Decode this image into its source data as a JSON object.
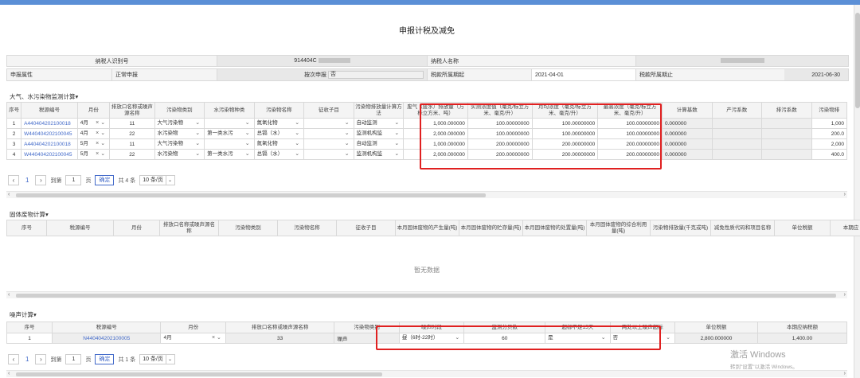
{
  "page_title": "申报计税及减免",
  "info": {
    "taxpayer_id_label": "纳税人识别号",
    "taxpayer_id_value": "914404C",
    "taxpayer_name_label": "纳税人名称",
    "report_attr_label": "申报属性",
    "report_attr_value": "正常申报",
    "by_period_label": "按次申报",
    "by_period_value": "否",
    "period_start_label": "税款所属期起",
    "period_start_value": "2021-04-01",
    "period_end_label": "税款所属期止",
    "period_end_value": "2021-06-30"
  },
  "air_water": {
    "section_title": "大气、水污染物监测计算",
    "headers": [
      "序号",
      "税源编号",
      "月份",
      "排放口名称或噪声源名称",
      "污染物类别",
      "水污染物种类",
      "污染物名称",
      "征收子目",
      "污染物排放量计算方法",
      "废气（废水）排放量（万标立方米、吨）",
      "实测浓度值（毫克/标立方米、毫克/升）",
      "月均浓度（毫克/标立方米、毫克/升）",
      "最高浓度（毫克/标立方米、毫克/升）",
      "计算基数",
      "产污系数",
      "排污系数",
      "污染物排"
    ],
    "rows": [
      {
        "no": "1",
        "source": "A440404202100018",
        "month": "4月",
        "outlet": "11",
        "category": "大气污染物",
        "water_type": "",
        "pollutant": "氮氧化物",
        "item": "",
        "method": "自动监测",
        "emission": "1,000.000000",
        "measured": "100.00000000",
        "avg": "100.00000000",
        "max": "100.00000000",
        "base": "0.000000",
        "extra": "1,000"
      },
      {
        "no": "2",
        "source": "W440404202100045",
        "month": "4月",
        "outlet": "22",
        "category": "水污染物",
        "water_type": "第一类水污",
        "pollutant": "总镉（水）",
        "item": "",
        "method": "监测机构监",
        "emission": "2,000.000000",
        "measured": "100.00000000",
        "avg": "100.00000000",
        "max": "100.00000000",
        "base": "0.000000",
        "extra": "200.0"
      },
      {
        "no": "3",
        "source": "A440404202100018",
        "month": "5月",
        "outlet": "11",
        "category": "大气污染物",
        "water_type": "",
        "pollutant": "氮氧化物",
        "item": "",
        "method": "自动监测",
        "emission": "1,000.000000",
        "measured": "200.00000000",
        "avg": "200.00000000",
        "max": "200.00000000",
        "base": "0.000000",
        "extra": "2,000"
      },
      {
        "no": "4",
        "source": "W440404202100045",
        "month": "5月",
        "outlet": "22",
        "category": "水污染物",
        "water_type": "第一类水污",
        "pollutant": "总镉（水）",
        "item": "",
        "method": "监测机构监",
        "emission": "2,000.000000",
        "measured": "200.00000000",
        "avg": "200.00000000",
        "max": "200.00000000",
        "base": "0.000000",
        "extra": "400.0"
      }
    ],
    "pager": {
      "page": "1",
      "goto_label": "到第",
      "page_input": "1",
      "page_unit": "页",
      "confirm": "确定",
      "total": "共 4 条",
      "size": "10 条/页"
    }
  },
  "solid": {
    "section_title": "固体废物计算",
    "headers": [
      "序号",
      "税源编号",
      "月份",
      "排放口名称或噪声源名称",
      "污染物类别",
      "污染物名称",
      "征收子目",
      "本月固体废物的产生量(吨)",
      "本月固体废物的贮存量(吨)",
      "本月固体废物的处置量(吨)",
      "本月固体废物的综合利用量(吨)",
      "污染物排放量(千克或吨)",
      "减免性质代码和项目名称",
      "单位税额",
      "本期应"
    ],
    "empty_text": "暂无数据"
  },
  "noise": {
    "section_title": "噪声计算",
    "headers": [
      "序号",
      "税源编号",
      "月份",
      "排放口名称或噪声源名称",
      "污染物类别",
      "噪声时段",
      "监测分贝数",
      "超标不足15天",
      "两处以上噪声超标",
      "单位税额",
      "本期应纳税额"
    ],
    "row": {
      "no": "1",
      "source": "N440404202100005",
      "month": "4月",
      "outlet": "33",
      "category": "噪声",
      "period": "昼（6时-22时）",
      "db": "60",
      "under15": "是",
      "multi": "否",
      "unit_tax": "2,800.000000",
      "tax": "1,400.00"
    },
    "pager": {
      "page": "1",
      "goto_label": "到第",
      "page_input": "1",
      "page_unit": "页",
      "confirm": "确定",
      "total": "共 1 条",
      "size": "10 条/页"
    }
  },
  "watermark": {
    "line1": "激活 Windows",
    "line2": "转到\"设置\"以激活 Windows。"
  },
  "colors": {
    "link": "#4169c9",
    "highlight": "#e02020",
    "header_bg": "#f4f4f4"
  }
}
